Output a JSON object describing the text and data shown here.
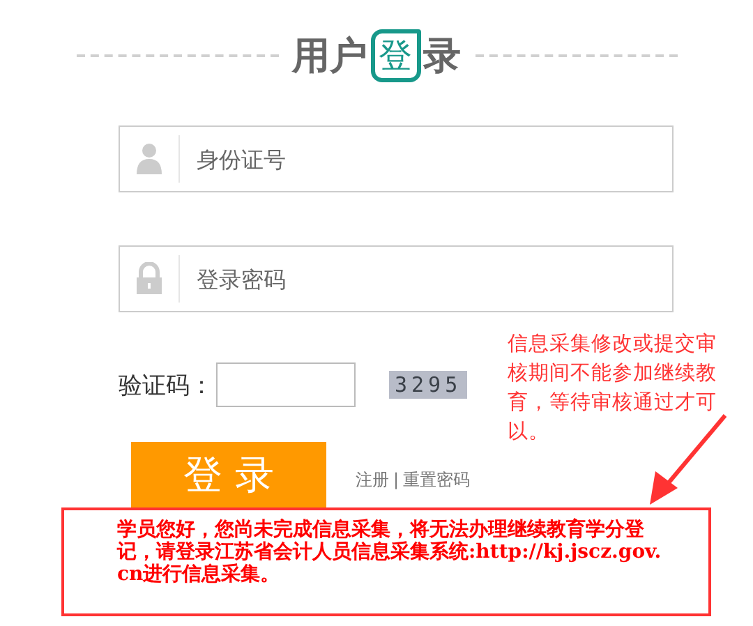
{
  "title": {
    "parts": [
      {
        "text": "用户",
        "kind": "plain"
      },
      {
        "text": "登",
        "kind": "boxed"
      },
      {
        "text": "录",
        "kind": "plain"
      }
    ]
  },
  "fields": [
    {
      "kind": "user",
      "placeholder": "身份证号"
    },
    {
      "kind": "lock",
      "placeholder": "登录密码"
    }
  ],
  "captcha": {
    "label": "验证码：",
    "code": "3295"
  },
  "login_button": "登 录",
  "links": [
    {
      "text": "注册"
    },
    {
      "text": "重置密码"
    }
  ],
  "link_separator": "|",
  "annotation": "信息采集修改或提交审核期间不能参加继续教育，等待审核通过才可以。",
  "notice": "学员您好，您尚未完成信息采集，将无法办理继续教育学分登记，请登录江苏省会计人员信息采集系统:http://kj.jscz.gov.cn进行信息采集。"
}
